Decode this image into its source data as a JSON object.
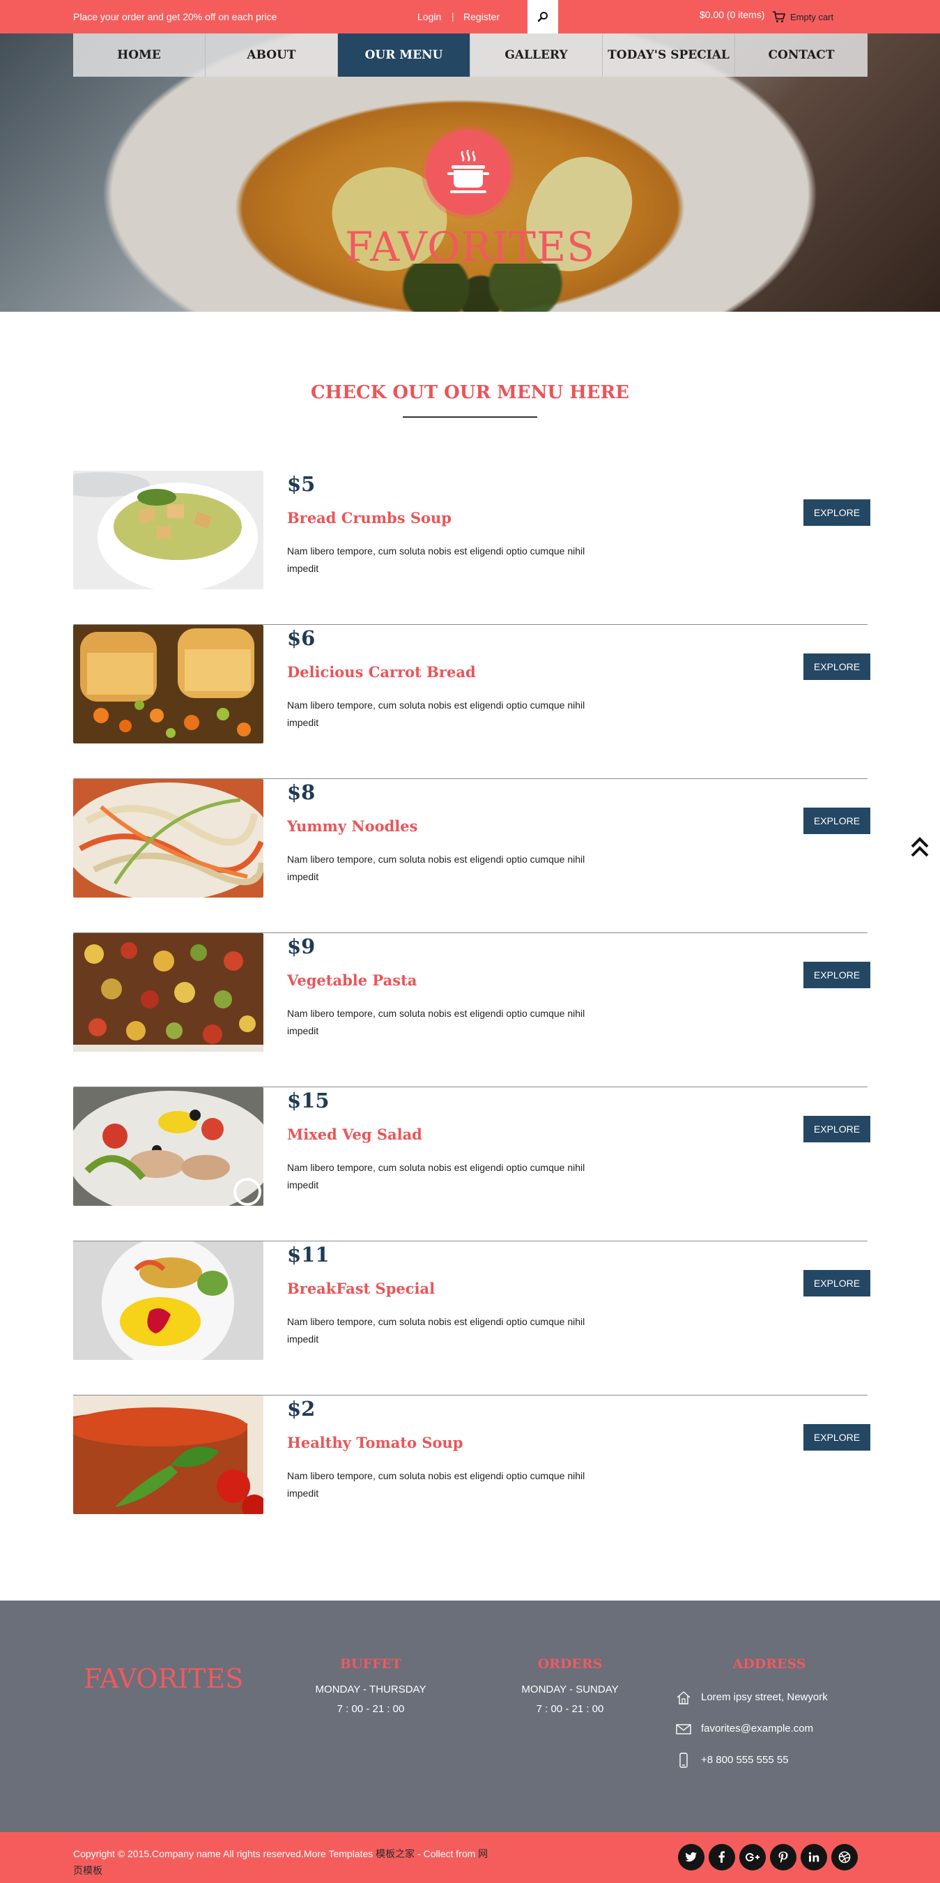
{
  "topbar": {
    "promo": "Place your order and get 20% off on each price",
    "login": "Login",
    "separator": "|",
    "register": "Register",
    "cart_total": "$0.00 (0 items)",
    "cart_label": "Empty cart"
  },
  "nav": {
    "items": [
      "HOME",
      "ABOUT",
      "OUR MENU",
      "GALLERY",
      "TODAY'S SPECIAL",
      "CONTACT"
    ],
    "active": "OUR MENU"
  },
  "hero": {
    "title": "FAVORITES"
  },
  "menu": {
    "heading": "CHECK OUT OUR MENU HERE",
    "items": [
      {
        "price": "$5",
        "name": "Bread Crumbs Soup",
        "desc": "Nam libero tempore, cum soluta nobis est eligendi optio cumque nihil impedit",
        "button": "EXPLORE"
      },
      {
        "price": "$6",
        "name": "Delicious Carrot Bread",
        "desc": "Nam libero tempore, cum soluta nobis est eligendi optio cumque nihil impedit",
        "button": "EXPLORE"
      },
      {
        "price": "$8",
        "name": "Yummy Noodles",
        "desc": "Nam libero tempore, cum soluta nobis est eligendi optio cumque nihil impedit",
        "button": "EXPLORE"
      },
      {
        "price": "$9",
        "name": "Vegetable Pasta",
        "desc": "Nam libero tempore, cum soluta nobis est eligendi optio cumque nihil impedit",
        "button": "EXPLORE"
      },
      {
        "price": "$15",
        "name": "Mixed Veg Salad",
        "desc": "Nam libero tempore, cum soluta nobis est eligendi optio cumque nihil impedit",
        "button": "EXPLORE"
      },
      {
        "price": "$11",
        "name": "BreakFast Special",
        "desc": "Nam libero tempore, cum soluta nobis est eligendi optio cumque nihil impedit",
        "button": "EXPLORE"
      },
      {
        "price": "$2",
        "name": "Healthy Tomato Soup",
        "desc": "Nam libero tempore, cum soluta nobis est eligendi optio cumque nihil impedit",
        "button": "EXPLORE"
      }
    ]
  },
  "footer": {
    "brand": "FAVORITES",
    "buffet": {
      "title": "BUFFET",
      "days": "MONDAY - THURSDAY",
      "hours": "7 : 00 - 21 : 00"
    },
    "orders": {
      "title": "ORDERS",
      "days": "MONDAY - SUNDAY",
      "hours": "7 : 00 - 21 : 00"
    },
    "address": {
      "title": "ADDRESS",
      "street": "Lorem ipsy street, Newyork",
      "email": "favorites@example.com",
      "phone": "+8 800 555 555 55"
    }
  },
  "copyright": {
    "text": "Copyright © 2015.Company name All rights reserved.More Templates ",
    "link1": "模板之家",
    "mid": " - Collect from ",
    "link2": "网页模板"
  },
  "socials": [
    "twitter-icon",
    "facebook-icon",
    "google-plus-icon",
    "pinterest-icon",
    "linkedin-icon",
    "dribbble-icon"
  ],
  "colors": {
    "accent": "#f55d5d",
    "navy": "#244763",
    "footer": "#6a6f7a"
  }
}
